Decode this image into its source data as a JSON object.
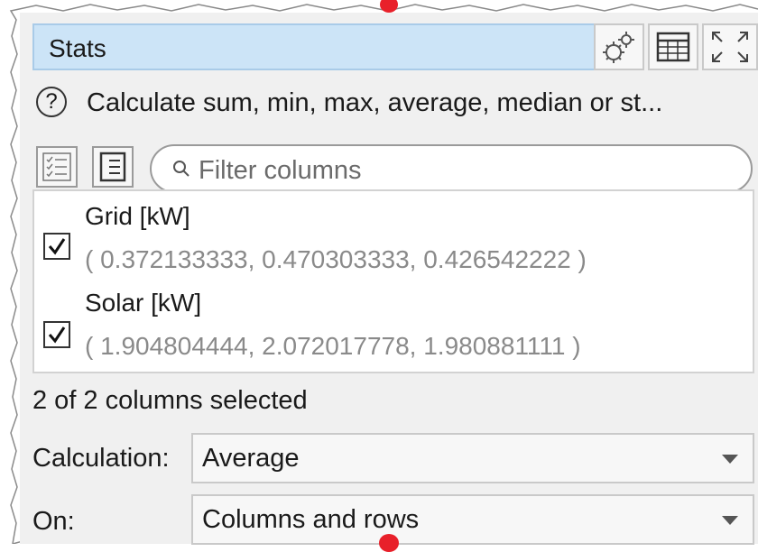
{
  "panel": {
    "title": "Stats",
    "toolbar_icons": [
      "settings-gears-icon",
      "table-icon",
      "maximize-icon"
    ],
    "help_icon_glyph": "?",
    "description": "Calculate sum, min, max, average, median or st...",
    "filter": {
      "placeholder": "Filter columns",
      "value": ""
    },
    "columns": [
      {
        "checked": true,
        "name": "Grid [kW]",
        "values": "( 0.372133333, 0.470303333, 0.426542222 )"
      },
      {
        "checked": true,
        "name": "Solar [kW]",
        "values": "( 1.904804444, 2.072017778, 1.980881111 )"
      }
    ],
    "status": "2 of 2 columns selected",
    "calculation": {
      "label": "Calculation:",
      "value": "Average"
    },
    "on": {
      "label": "On:",
      "value": "Columns and rows"
    }
  },
  "colors": {
    "title_bg": "#cce4f7",
    "accent_red": "#e8202a",
    "panel_bg": "#f0f0f0"
  }
}
